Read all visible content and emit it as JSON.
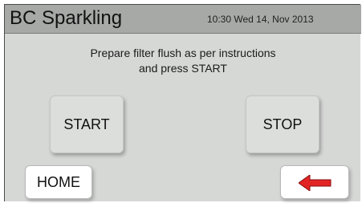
{
  "header": {
    "title": "BC Sparkling",
    "datetime": "10:30 Wed 14, Nov 2013"
  },
  "message": {
    "line1": "Prepare filter flush as per instructions",
    "line2": "and press START"
  },
  "controls": {
    "start_label": "START",
    "stop_label": "STOP",
    "home_label": "HOME",
    "back_icon": "left-arrow-icon"
  },
  "colors": {
    "arrow": "#e32424"
  }
}
